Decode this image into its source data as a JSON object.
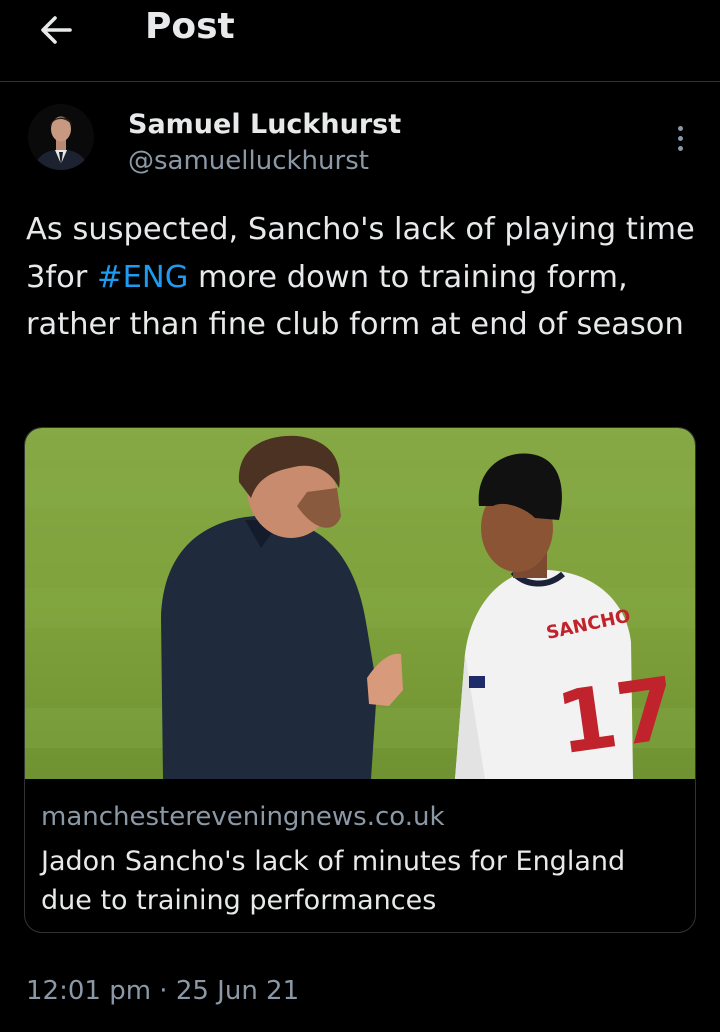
{
  "header": {
    "title": "Post",
    "back_icon": "arrow-left-icon"
  },
  "author": {
    "display_name": "Samuel Luckhurst",
    "handle": "@samuelluckhurst"
  },
  "menu": {
    "icon": "more-vertical-icon"
  },
  "tweet": {
    "text_part1": "As suspected, Sancho's lack of playing time 3for ",
    "hashtag": "#ENG",
    "text_part2": " more down to training form, rather than fine club form at end of season"
  },
  "link_card": {
    "jersey_name": "SANCHO",
    "jersey_number": "17",
    "domain": "manchestereveningnews.co.uk",
    "title": "Jadon Sancho's lack of minutes for England due to training performances"
  },
  "timestamp": "12:01 pm · 25 Jun 21",
  "colors": {
    "background": "#000000",
    "text": "#e7e9ea",
    "secondary": "#8b98a5",
    "accent": "#1d9bf0",
    "divider": "#2f3336"
  }
}
